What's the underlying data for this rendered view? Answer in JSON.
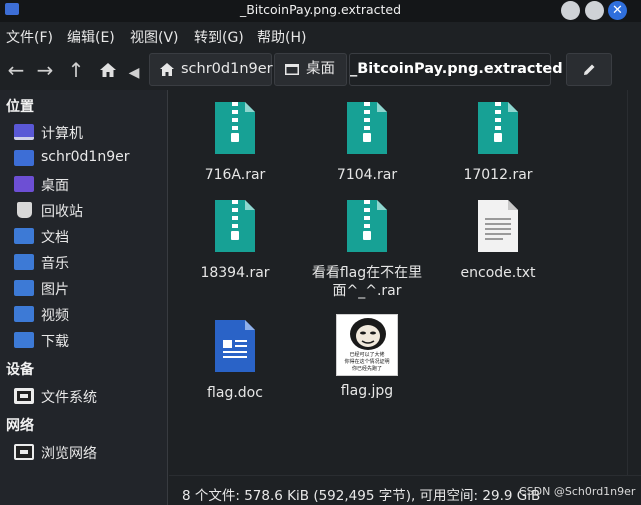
{
  "window": {
    "title": "_BitcoinPay.png.extracted"
  },
  "menubar": {
    "items": [
      "文件(F)",
      "编辑(E)",
      "视图(V)",
      "转到(G)",
      "帮助(H)"
    ]
  },
  "toolbar": {
    "breadcrumbs": [
      {
        "label": "schr0d1n9er",
        "icon": "home-icon"
      },
      {
        "label": "桌面",
        "icon": "desktop-icon"
      },
      {
        "label": "_BitcoinPay.png.extracted",
        "icon": ""
      }
    ],
    "edit_icon": "pencil-icon"
  },
  "sidebar": {
    "sections": [
      {
        "heading": "位置",
        "items": [
          {
            "label": "计算机",
            "icon": "computer-icon"
          },
          {
            "label": "schr0d1n9er",
            "icon": "home-folder-icon"
          },
          {
            "label": "桌面",
            "icon": "desktop-folder-icon"
          },
          {
            "label": "回收站",
            "icon": "trash-icon"
          },
          {
            "label": "文档",
            "icon": "documents-folder-icon"
          },
          {
            "label": "音乐",
            "icon": "music-folder-icon"
          },
          {
            "label": "图片",
            "icon": "pictures-folder-icon"
          },
          {
            "label": "视频",
            "icon": "videos-folder-icon"
          },
          {
            "label": "下载",
            "icon": "downloads-folder-icon"
          }
        ]
      },
      {
        "heading": "设备",
        "items": [
          {
            "label": "文件系统",
            "icon": "drive-icon"
          }
        ]
      },
      {
        "heading": "网络",
        "items": [
          {
            "label": "浏览网络",
            "icon": "network-icon"
          }
        ]
      }
    ]
  },
  "files": [
    {
      "name": "716A.rar",
      "type": "archive"
    },
    {
      "name": "7104.rar",
      "type": "archive"
    },
    {
      "name": "17012.rar",
      "type": "archive"
    },
    {
      "name": "18394.rar",
      "type": "archive"
    },
    {
      "name": "看看flag在不在里面^_^.rar",
      "type": "archive"
    },
    {
      "name": "encode.txt",
      "type": "text"
    },
    {
      "name": "flag.doc",
      "type": "document"
    },
    {
      "name": "flag.jpg",
      "type": "image",
      "image_caption_lines": [
        "已经可以了大佬",
        "你得在这个情况证明",
        "你已经先跑了"
      ]
    }
  ],
  "status": {
    "text": "8 个文件: 578.6 KiB (592,495 字节), 可用空间: 29.9 GiB"
  },
  "watermark": "CSDN @Sch0rd1n9er",
  "colors": {
    "archive": "#17a195",
    "document": "#2a63c7",
    "accent": "#2f6fdc"
  }
}
